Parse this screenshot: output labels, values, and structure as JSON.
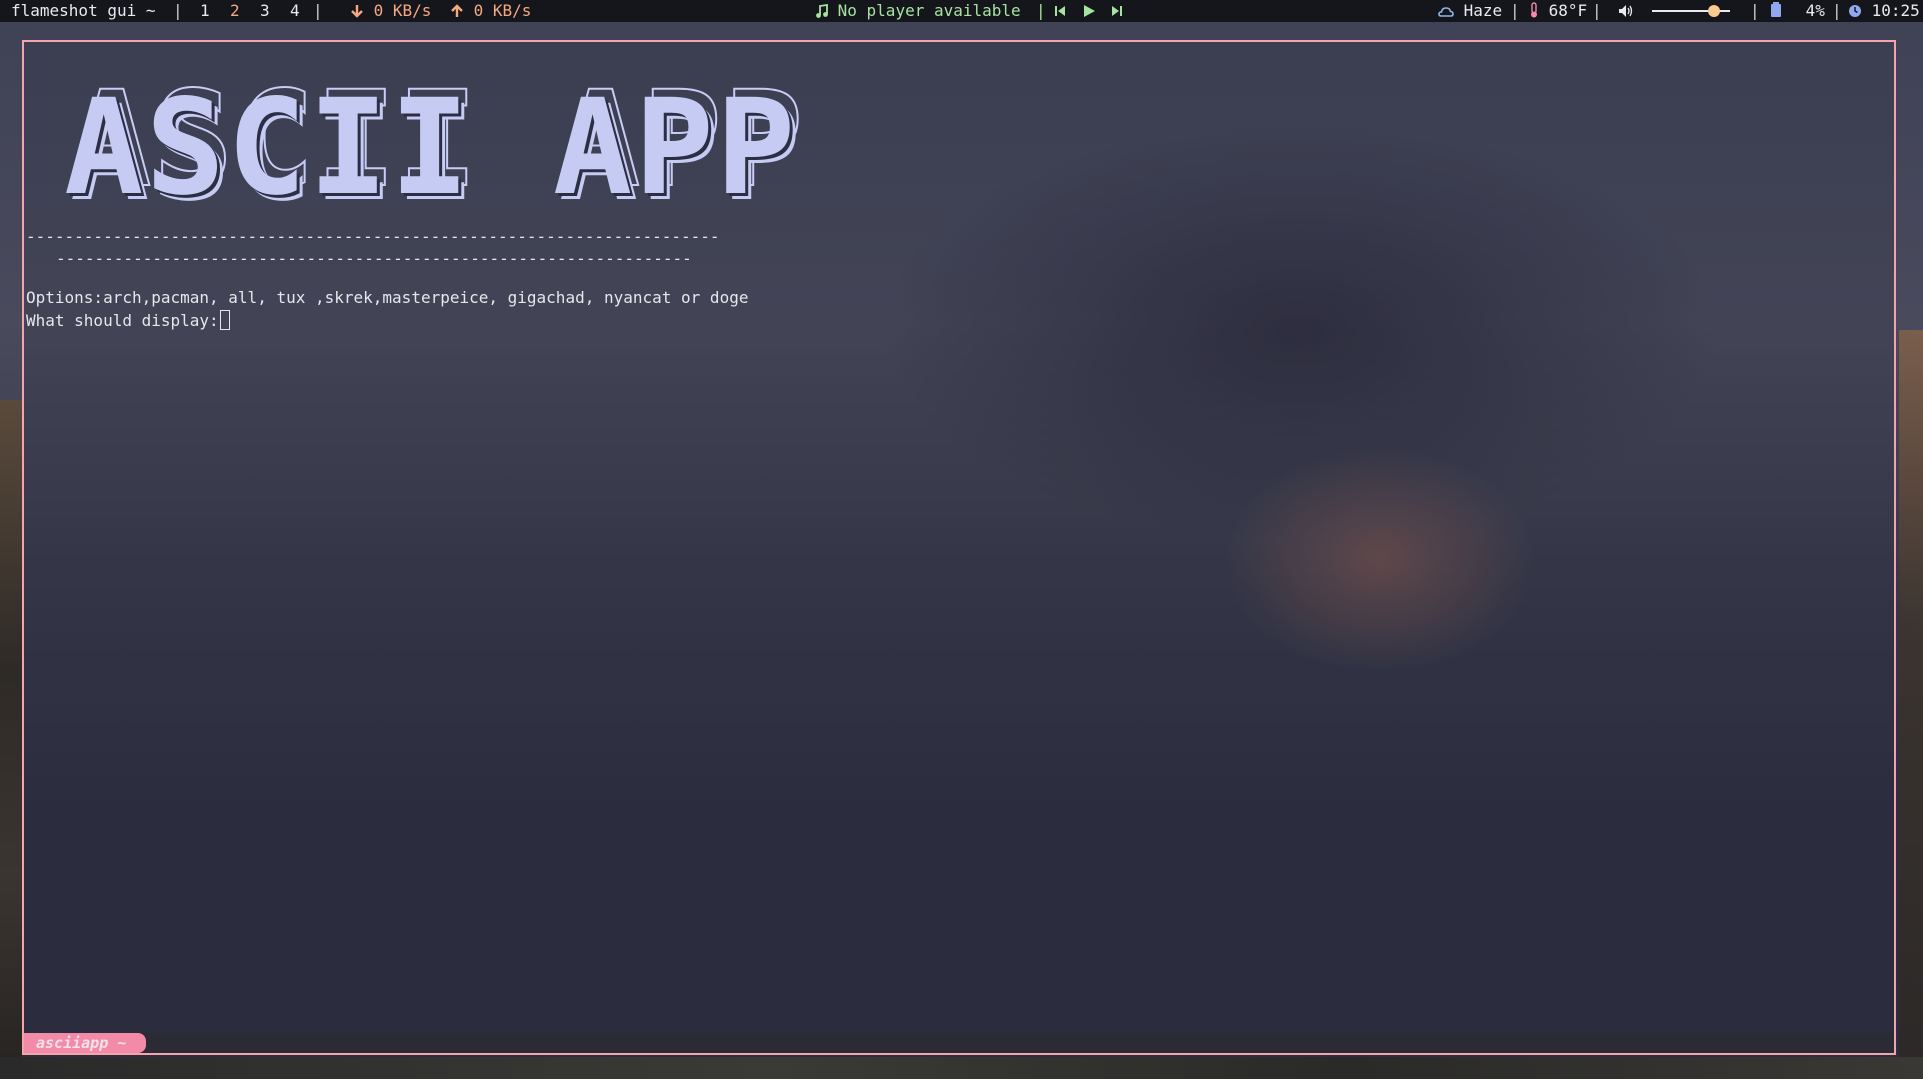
{
  "topbar": {
    "window_title": "flameshot gui ~",
    "workspaces": [
      "1",
      "2",
      "3",
      "4"
    ],
    "active_workspace": "2",
    "download": "0 KB/s",
    "upload": "0 KB/s",
    "media": "No player available",
    "weather": "Haze",
    "temperature": "68°F",
    "volume_level": 0.8,
    "battery": "4%",
    "clock": "10:25",
    "separator": "|"
  },
  "terminal": {
    "title_art": "ASCII APP",
    "dash_line_1": "------------------------------------------------------------------------",
    "dash_line_2": "------------------------------------------------------------------",
    "options_line": "Options:arch,pacman, all, tux ,skrek,masterpeice, gigachad, nyancat or doge",
    "prompt": "What should display:",
    "tab_label": "asciiapp ~"
  },
  "colors": {
    "accent_border": "#f5a3ac",
    "tab_bg": "#f38ba8",
    "net_color": "#f5a97f",
    "media_color": "#a6e3a1",
    "art_color": "#c6cbf4"
  },
  "icons": [
    "arrow-down-icon",
    "arrow-up-icon",
    "music-note-icon",
    "skip-back-icon",
    "play-icon",
    "skip-forward-icon",
    "cloud-icon",
    "thermometer-icon",
    "speaker-icon",
    "battery-icon",
    "clock-icon"
  ]
}
